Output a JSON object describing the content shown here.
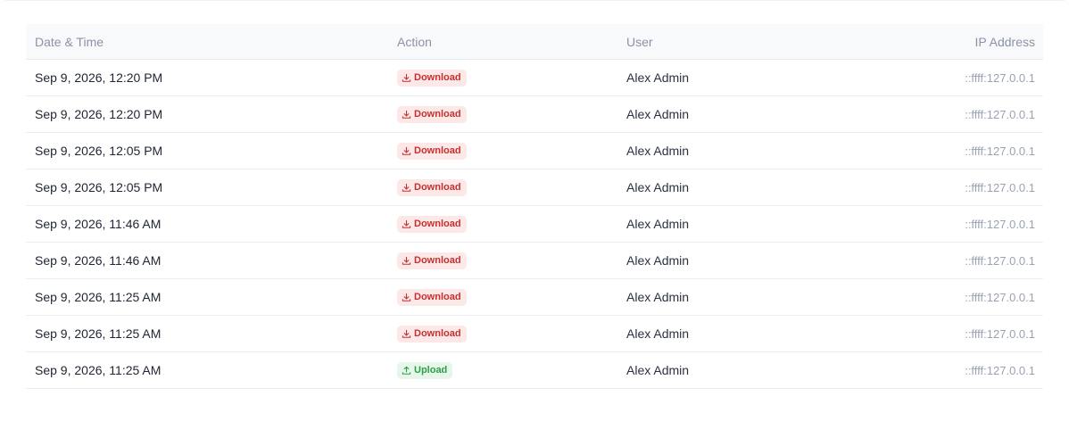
{
  "table": {
    "headers": {
      "date": "Date & Time",
      "action": "Action",
      "user": "User",
      "ip": "IP Address"
    },
    "rows": [
      {
        "date": "Sep 9, 2026, 12:20 PM",
        "action": "Download",
        "action_icon": "download-icon",
        "user": "Alex Admin",
        "ip": "::ffff:127.0.0.1"
      },
      {
        "date": "Sep 9, 2026, 12:20 PM",
        "action": "Download",
        "action_icon": "download-icon",
        "user": "Alex Admin",
        "ip": "::ffff:127.0.0.1"
      },
      {
        "date": "Sep 9, 2026, 12:05 PM",
        "action": "Download",
        "action_icon": "download-icon",
        "user": "Alex Admin",
        "ip": "::ffff:127.0.0.1"
      },
      {
        "date": "Sep 9, 2026, 12:05 PM",
        "action": "Download",
        "action_icon": "download-icon",
        "user": "Alex Admin",
        "ip": "::ffff:127.0.0.1"
      },
      {
        "date": "Sep 9, 2026, 11:46 AM",
        "action": "Download",
        "action_icon": "download-icon",
        "user": "Alex Admin",
        "ip": "::ffff:127.0.0.1"
      },
      {
        "date": "Sep 9, 2026, 11:46 AM",
        "action": "Download",
        "action_icon": "download-icon",
        "user": "Alex Admin",
        "ip": "::ffff:127.0.0.1"
      },
      {
        "date": "Sep 9, 2026, 11:25 AM",
        "action": "Download",
        "action_icon": "download-icon",
        "user": "Alex Admin",
        "ip": "::ffff:127.0.0.1"
      },
      {
        "date": "Sep 9, 2026, 11:25 AM",
        "action": "Download",
        "action_icon": "download-icon",
        "user": "Alex Admin",
        "ip": "::ffff:127.0.0.1"
      },
      {
        "date": "Sep 9, 2026, 11:25 AM",
        "action": "Upload",
        "action_icon": "upload-icon",
        "user": "Alex Admin",
        "ip": "::ffff:127.0.0.1"
      }
    ]
  },
  "colors": {
    "download_bg": "#fde8e8",
    "download_fg": "#c53030",
    "upload_bg": "#e6f6ea",
    "upload_fg": "#2f9e44",
    "header_bg": "#f8f9fb"
  }
}
